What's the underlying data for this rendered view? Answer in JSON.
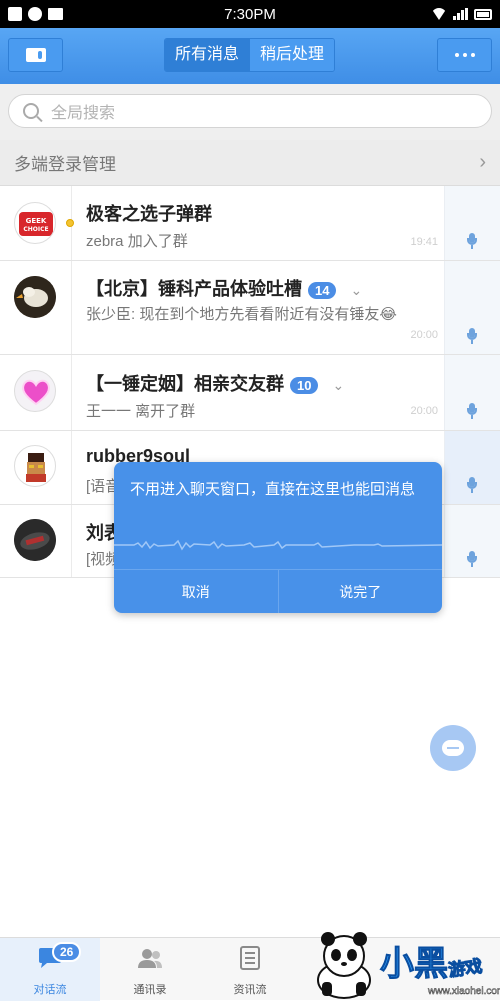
{
  "status_bar": {
    "time": "7:30PM"
  },
  "header": {
    "tabs": [
      {
        "label": "所有消息",
        "active": true
      },
      {
        "label": "稍后处理",
        "active": false
      }
    ]
  },
  "search": {
    "placeholder": "全局搜索"
  },
  "multi_device": {
    "label": "多端登录管理"
  },
  "conversations": [
    {
      "name": "极客之选子弹群",
      "message": "zebra 加入了群",
      "time": "19:41",
      "badge": "",
      "avatar_text": "GEEK CHOICE"
    },
    {
      "name": "【北京】锤科产品体验吐槽",
      "message": "张少臣: 现在到个地方先看看附近有没有锤友😂",
      "time": "20:00",
      "badge": "14"
    },
    {
      "name": "【一锤定姻】相亲交友群",
      "message": "王一一 离开了群",
      "time": "20:00",
      "badge": "10"
    },
    {
      "name": "rubber9soul",
      "message": "[语音",
      "time": "",
      "badge": ""
    },
    {
      "name": "刘表",
      "message": "[视频",
      "time": "",
      "badge": ""
    }
  ],
  "voice_popup": {
    "text": "不用进入聊天窗口，直接在这里也能回消息",
    "cancel": "取消",
    "done": "说完了"
  },
  "bottom_nav": {
    "items": [
      {
        "label": "对话流",
        "badge": "26",
        "active": true
      },
      {
        "label": "通讯录",
        "active": false
      },
      {
        "label": "资讯流",
        "active": false
      }
    ]
  },
  "watermark": {
    "brand": "小黑",
    "brand2": "游戏",
    "url": "www.xiaohei.com"
  },
  "colors": {
    "primary": "#4891e9",
    "header": "#4a9bf0",
    "badge": "#4b8de5"
  }
}
